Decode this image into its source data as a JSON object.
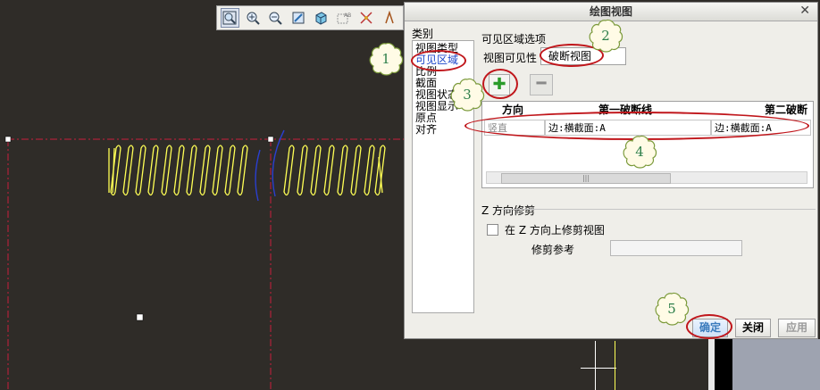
{
  "toolbar": {
    "icons": [
      "zoom-fit-icon",
      "zoom-in-icon",
      "zoom-out-icon",
      "repaint-icon",
      "display-style-icon",
      "annotation-display-icon",
      "datum-display-icon",
      "tag-icon"
    ]
  },
  "dialog": {
    "title": "绘图视图",
    "close_glyph": "✕",
    "categories_label": "类别",
    "categories": [
      "视图类型",
      "可见区域",
      "比例",
      "截面",
      "视图状态",
      "视图显示",
      "原点",
      "对齐"
    ],
    "selected_category_index": 1,
    "visible_area_options_label": "可见区域选项",
    "view_visibility_label": "视图可见性",
    "view_visibility_value": "破断视图",
    "add_label": "✚",
    "remove_label": "━",
    "table": {
      "columns": [
        "方向",
        "第一破断线",
        "第二破断"
      ],
      "rows": [
        {
          "direction": "竖直",
          "first": "边:横截面:A",
          "second": "边:横截面:A"
        }
      ],
      "scroll_thumb": "|||"
    },
    "z_trim_label": "Z 方向修剪",
    "z_trim_checkbox_label": "在 Z 方向上修剪视图",
    "trim_ref_label": "修剪参考",
    "ok_label": "确定",
    "close_label": "关闭",
    "apply_label": "应用"
  },
  "callouts": [
    "1",
    "2",
    "3",
    "4",
    "5"
  ],
  "colors": {
    "canvas": "#2f2c28",
    "geometry": "#ffff55",
    "break_line": "#c81e3c",
    "highlight_ring": "#c0161b",
    "callout_text": "#2e7f4a"
  }
}
